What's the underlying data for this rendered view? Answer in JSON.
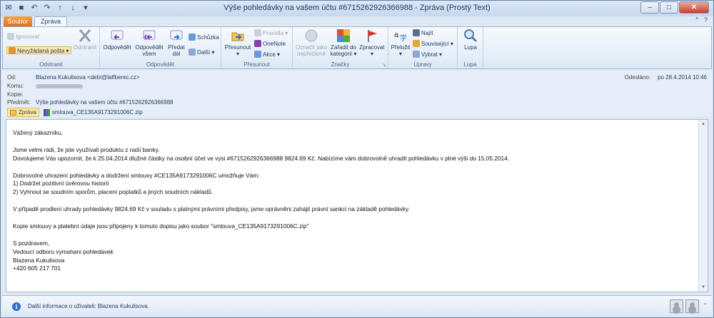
{
  "window": {
    "title": "Výše pohledávky na vašem účtu #6715262926366988 - Zpráva (Prostý Text)"
  },
  "tabs": {
    "file": "Soubor",
    "message": "Zpráva"
  },
  "ribbon": {
    "groups": {
      "delete": {
        "label": "Odstranit",
        "ignore": "Ignorovat",
        "junk": "Nevyžádaná pošta",
        "delete": "Odstranit"
      },
      "respond": {
        "label": "Odpovědět",
        "reply": "Odpovědět",
        "reply_all_1": "Odpovědět",
        "reply_all_2": "všem",
        "forward_1": "Předat",
        "forward_2": "dál",
        "meeting": "Schůzka",
        "more": "Další"
      },
      "move": {
        "label": "Přesunout",
        "move": "Přesunout",
        "rules": "Pravidla",
        "onenote": "OneNote",
        "actions": "Akce"
      },
      "tags": {
        "label": "Značky",
        "mark_unread_1": "Označit jako",
        "mark_unread_2": "nepřečtené",
        "categorize_1": "Zařadit do",
        "categorize_2": "kategorií",
        "followup": "Zpracovat"
      },
      "editing": {
        "label": "Úpravy",
        "translate": "Přeložit",
        "find": "Najít",
        "related": "Související",
        "select": "Vybrat"
      },
      "zoom": {
        "label": "Lupa",
        "zoom": "Lupa"
      }
    }
  },
  "header": {
    "from_label": "Od:",
    "from": "Blazena Kukulisova <debt@laflberec.cz>",
    "to_label": "Komu:",
    "cc_label": "Kopie:",
    "subject_label": "Předmět:",
    "subject": "Výše pohledávky na vašem účtu #6715262926366988",
    "sent_label": "Odesláno:",
    "sent": "po 28.4.2014 10:46",
    "attachments": [
      "Zpráva",
      "smlouva_CE135A9173291006C.zip"
    ]
  },
  "body": {
    "lines": [
      "Vážený zákazníku,",
      "",
      "Jsme velmi rádi, že jste využívali produktu z naší banky.",
      "Dovolujeme Vás upozornit, že k 25.04.2014 dlužné částky na osobní účet ve vysi #6715262926366988 9824.69 Kč. Nabízíme vám dobrovolně uhradit pohledávku v plné výši do 15.05.2014.",
      "",
      "Dobrovolné uhrazení pohledávky a dodržení smlouvy #CE135A9173291006C umožňuje Vám:",
      "1) Dodržet pozitivní úvěrovou historii",
      "2) Vyhnout se soudním sporům, placení poplatků a jiných soudních nákladů.",
      "",
      "V případě prodlení uhrady pohledávky 9824.69 Kč v souladu s platnými právními předpisy, jsme oprávněni zahájit právní sankci na základě pohledávky.",
      "",
      "Kopie smlouvy a platební údaje jsou připojeny k tomuto dopisu jako soubor \"smlouva_CE135A9173291006C.zip\"",
      "",
      "S pozdravem,",
      "Vedoucí odboru vymahani pohledávek",
      "Blazena Kukulisova",
      "+420 605 217 701"
    ]
  },
  "people_pane": {
    "info": "Další informace o uživateli: Blazena Kukulisova."
  }
}
